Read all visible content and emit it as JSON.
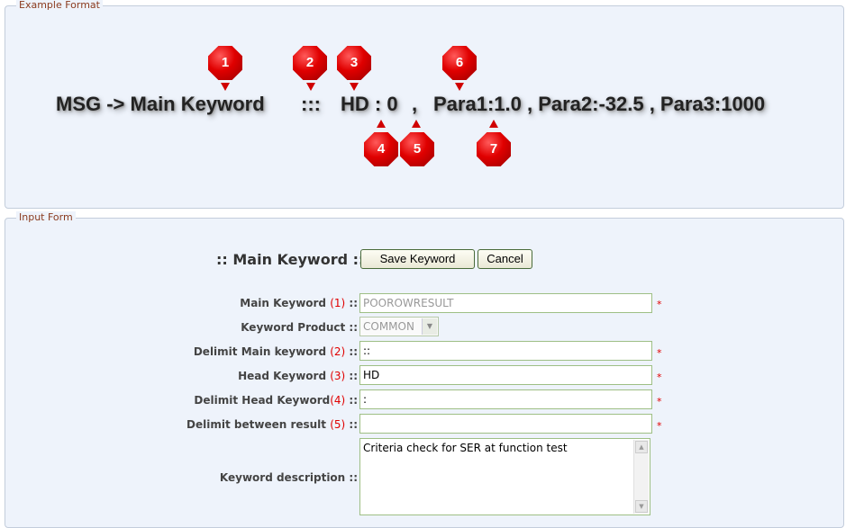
{
  "example_format": {
    "legend": "Example Format",
    "parts": {
      "msg": "MSG -> Main Keyword",
      "delim1": ":::",
      "head": "HD : 0",
      "comma": ",",
      "params": "Para1:1.0 , Para2:-32.5 , Para3:1000"
    },
    "badges": [
      "1",
      "2",
      "3",
      "4",
      "5",
      "6",
      "7"
    ],
    "badge_color": "#e00000"
  },
  "input_form": {
    "legend": "Input Form",
    "title": ":: Main Keyword ::",
    "save_button": "Save Keyword",
    "cancel_button": "Cancel",
    "fields": {
      "main_keyword": {
        "label": "Main Keyword",
        "num": "(1)",
        "suffix": " ::",
        "value": "POOROWRESULT",
        "required": "*"
      },
      "keyword_product": {
        "label": "Keyword Product ::",
        "value": "COMMON"
      },
      "delimit_main": {
        "label": "Delimit Main keyword",
        "num": "(2)",
        "suffix": " ::",
        "value": "::",
        "required": "*"
      },
      "head_keyword": {
        "label": "Head Keyword",
        "num": "(3)",
        "suffix": " ::",
        "value": "HD",
        "required": "*"
      },
      "delimit_head": {
        "label": "Delimit Head Keyword",
        "num": "(4)",
        "suffix": " ::",
        "value": ":",
        "required": "*"
      },
      "delimit_result": {
        "label": "Delimit between result",
        "num": "(5)",
        "suffix": " ::",
        "value": "",
        "required": "*"
      },
      "description": {
        "label": "Keyword description ::",
        "value": "Criteria check for SER at function test"
      }
    }
  }
}
